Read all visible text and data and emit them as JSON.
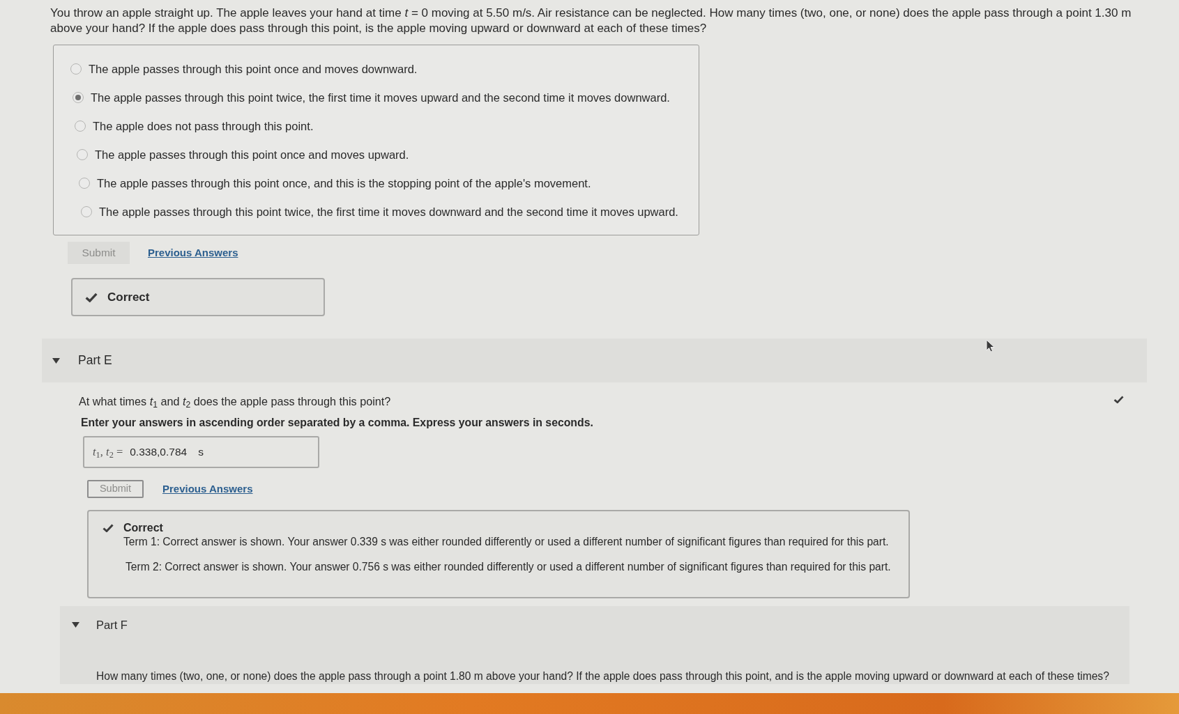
{
  "question": "You throw an apple straight up. The apple leaves your hand at time *t* = 0 moving at 5.50 m/s. Air resistance can be neglected. How many times (two, one, or none) does the apple pass through a point 1.30 m above your hand? If the apple does pass through this point, is the apple moving upward or downward at each of these times?",
  "part_d": {
    "options": [
      {
        "label": "The apple passes through this point once and moves downward.",
        "selected": false
      },
      {
        "label": "The apple passes through this point twice, the first time it moves upward and the second time it moves downward.",
        "selected": true
      },
      {
        "label": "The apple does not pass through this point.",
        "selected": false
      },
      {
        "label": "The apple passes through this point once and moves upward.",
        "selected": false
      },
      {
        "label": "The apple passes through this point once, and this is the stopping point of the apple's movement.",
        "selected": false
      },
      {
        "label": "The apple passes through this point twice, the first time it moves downward and the second time it moves upward.",
        "selected": false
      }
    ],
    "submit": {
      "label": "Submit",
      "disabled": true
    },
    "previous_answers": "Previous Answers",
    "feedback": {
      "title": "Correct"
    }
  },
  "part_e": {
    "header": {
      "title": "Part E",
      "expanded": true
    },
    "completed": true,
    "prompt": "At what times *t*$_{1}$ and *t*$_{2}$ does the apple pass through this point?",
    "instruction": "Enter your answers in ascending order separated by a comma. Express your answers in seconds.",
    "answer": {
      "label": "*t*$_{1}$, *t*$_{2}$ =",
      "value": "0.338,0.784",
      "unit": "s"
    },
    "submit": {
      "label": "Submit",
      "disabled": true
    },
    "previous_answers": "Previous Answers",
    "feedback": {
      "title": "Correct",
      "lines": [
        "Term 1: Correct answer is shown. Your answer 0.339 s was either rounded differently or used a different number of significant figures than required for this part.",
        "Term 2: Correct answer is shown. Your answer 0.756 s was either rounded differently or used a different number of significant figures than required for this part."
      ]
    }
  },
  "part_f": {
    "header": {
      "title": "Part F",
      "expanded": true
    },
    "prompt": "How many times (two, one, or none) does the apple pass through a point 1.80 m above your hand? If the apple does pass through this point, and is the apple moving upward or downward at each of these times?"
  }
}
